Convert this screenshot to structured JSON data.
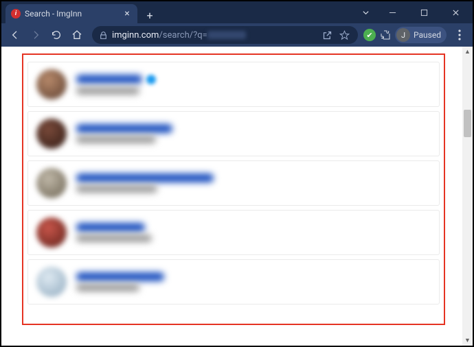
{
  "window": {
    "tab_title": "Search - ImgInn",
    "profile_label": "Paused",
    "profile_initial": "J"
  },
  "address": {
    "host": "imginn.com",
    "path": "/search/?q="
  },
  "results": [
    {
      "avatar_gradient": "radial-gradient(circle at 40% 35%, #b88a6b, #5a3d2e)",
      "name_width": 96,
      "handle_width": 92,
      "verified": true
    },
    {
      "avatar_gradient": "radial-gradient(circle at 40% 35%, #7a4a3a, #2e1a14)",
      "name_width": 140,
      "handle_width": 116,
      "verified": false
    },
    {
      "avatar_gradient": "radial-gradient(circle at 40% 35%, #c0b8a8, #6a6150)",
      "name_width": 200,
      "handle_width": 118,
      "verified": false
    },
    {
      "avatar_gradient": "radial-gradient(circle at 40% 35%, #c9564b, #5b1f18)",
      "name_width": 100,
      "handle_width": 110,
      "verified": false
    },
    {
      "avatar_gradient": "radial-gradient(circle at 40% 35%, #dfeaf2, #8da8bd)",
      "name_width": 128,
      "handle_width": 92,
      "verified": false
    }
  ]
}
